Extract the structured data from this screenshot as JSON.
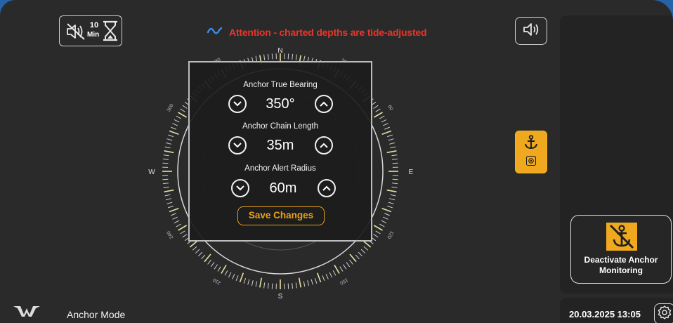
{
  "topbar": {
    "mute_minutes": "10",
    "mute_unit": "Min",
    "attention_text": "Attention - charted depths are tide-adjusted",
    "icons": [
      "tide-icon",
      "volume-icon",
      "mute-icon",
      "hourglass-icon"
    ]
  },
  "compass": {
    "cardinals": {
      "n": "N",
      "e": "E",
      "s": "S",
      "w": "W"
    },
    "labels": [
      "30",
      "60",
      "120",
      "150",
      "210",
      "240",
      "300",
      "330"
    ]
  },
  "anchor_settings": {
    "bearing_label": "Anchor True Bearing",
    "bearing_value": "350°",
    "chain_label": "Anchor Chain Length",
    "chain_value": "35m",
    "radius_label": "Anchor Alert Radius",
    "radius_value": "60m",
    "save_label": "Save Changes"
  },
  "sidebar": {
    "deactivate_label_line1": "Deactivate Anchor",
    "deactivate_label_line2": "Monitoring"
  },
  "footer": {
    "mode": "Anchor Mode",
    "datetime": "20.03.2025 13:05"
  },
  "colors": {
    "accent": "#e8a21a",
    "warning": "#e8362a",
    "tide_icon": "#3a8ee6",
    "background": "#2a2a2a",
    "frame": "#2563a8"
  }
}
